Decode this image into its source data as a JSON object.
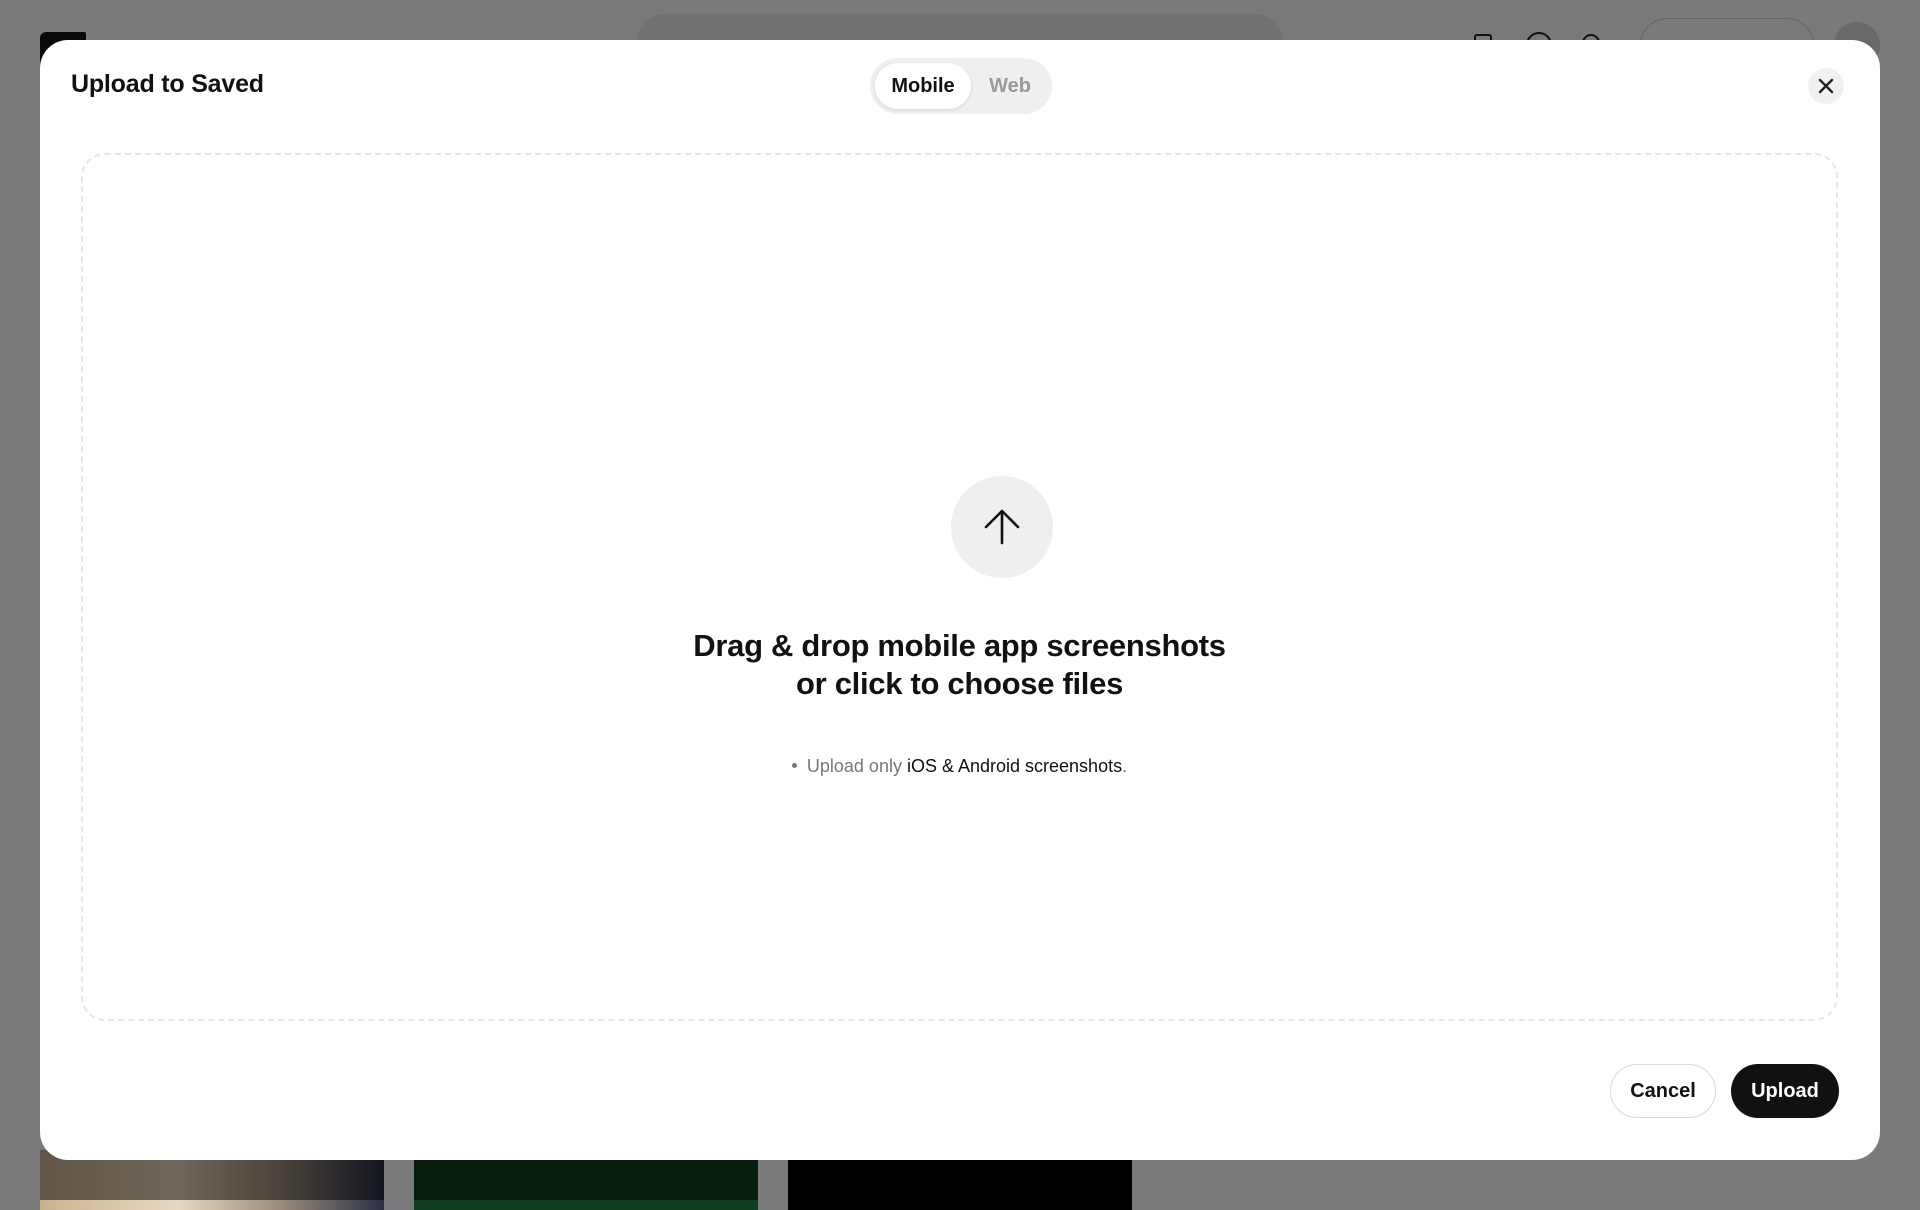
{
  "modal": {
    "title": "Upload to Saved",
    "platform_toggle": {
      "options": [
        "Mobile",
        "Web"
      ],
      "selected": "Mobile"
    },
    "close_icon": "close-icon"
  },
  "dropzone": {
    "icon": "arrow-up-icon",
    "title_line1": "Drag & drop mobile app screenshots",
    "title_line2": "or click to choose files",
    "hint_prefix": "Upload only",
    "hint_emphasis": "iOS & Android screenshots",
    "hint_suffix": "."
  },
  "footer": {
    "cancel_label": "Cancel",
    "upload_label": "Upload"
  },
  "colors": {
    "primary_button": "#111111",
    "toggle_track": "#efefef",
    "dropzone_border": "#e6e6e6"
  }
}
